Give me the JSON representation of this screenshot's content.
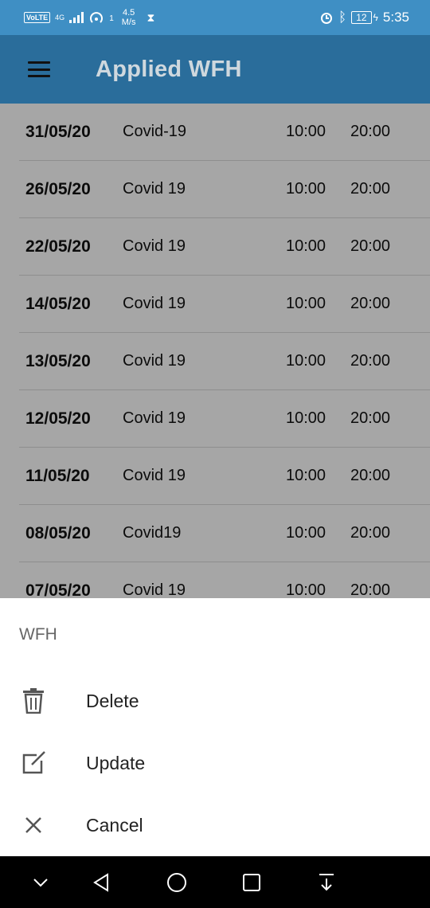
{
  "status_bar": {
    "volte": "VoLTE",
    "network": "4G",
    "speed_value": "4.5",
    "speed_unit": "M/s",
    "speed_prefix": "1",
    "battery": "12",
    "time": "5:35"
  },
  "app_bar": {
    "title": "Applied WFH"
  },
  "rows": [
    {
      "date": "31/05/20",
      "reason": "Covid-19",
      "start": "10:00",
      "end": "20:00"
    },
    {
      "date": "26/05/20",
      "reason": "Covid 19",
      "start": "10:00",
      "end": "20:00"
    },
    {
      "date": "22/05/20",
      "reason": "Covid 19",
      "start": "10:00",
      "end": "20:00"
    },
    {
      "date": "14/05/20",
      "reason": "Covid 19",
      "start": "10:00",
      "end": "20:00"
    },
    {
      "date": "13/05/20",
      "reason": "Covid 19",
      "start": "10:00",
      "end": "20:00"
    },
    {
      "date": "12/05/20",
      "reason": "Covid 19",
      "start": "10:00",
      "end": "20:00"
    },
    {
      "date": "11/05/20",
      "reason": "Covid 19",
      "start": "10:00",
      "end": "20:00"
    },
    {
      "date": "08/05/20",
      "reason": "Covid19",
      "start": "10:00",
      "end": "20:00"
    },
    {
      "date": "07/05/20",
      "reason": "Covid 19",
      "start": "10:00",
      "end": "20:00"
    }
  ],
  "sheet": {
    "title": "WFH",
    "items": [
      {
        "label": "Delete",
        "icon": "trash-icon"
      },
      {
        "label": "Update",
        "icon": "edit-icon"
      },
      {
        "label": "Cancel",
        "icon": "close-icon"
      }
    ]
  },
  "colors": {
    "status_bar": "#3f8fc4",
    "app_bar": "#2a6d9b",
    "scrim": "#a6a6a6"
  }
}
